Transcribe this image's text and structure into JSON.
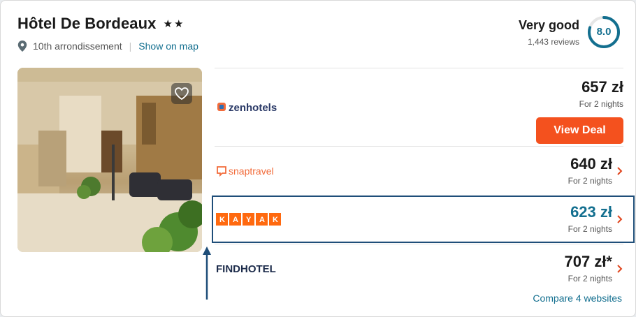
{
  "hotel": {
    "name": "Hôtel De Bordeaux",
    "stars": "★★",
    "location": "10th arrondissement",
    "show_map": "Show on map"
  },
  "rating": {
    "label": "Very good",
    "reviews": "1,443 reviews",
    "score": "8.0",
    "score_fraction": 0.8
  },
  "deals": [
    {
      "provider": "zenhotels",
      "price": "657 zł",
      "nights": "For 2 nights",
      "cta": "View Deal"
    },
    {
      "provider": "snaptravel",
      "price": "640 zł",
      "nights": "For 2 nights"
    },
    {
      "provider": "KAYAK",
      "price": "623 zł",
      "nights": "For 2 nights"
    },
    {
      "provider": "FINDHOTEL",
      "price": "707 zł*",
      "nights": "For 2 nights"
    }
  ],
  "compare_link": "Compare 4 websites",
  "colors": {
    "accent": "#136f8f",
    "cta": "#f4511e",
    "annotation": "#1f4e79",
    "kayak": "#ff690f"
  },
  "icons": [
    "location-pin-icon",
    "heart-icon",
    "chevron-right-icon",
    "rating-ring-icon"
  ]
}
